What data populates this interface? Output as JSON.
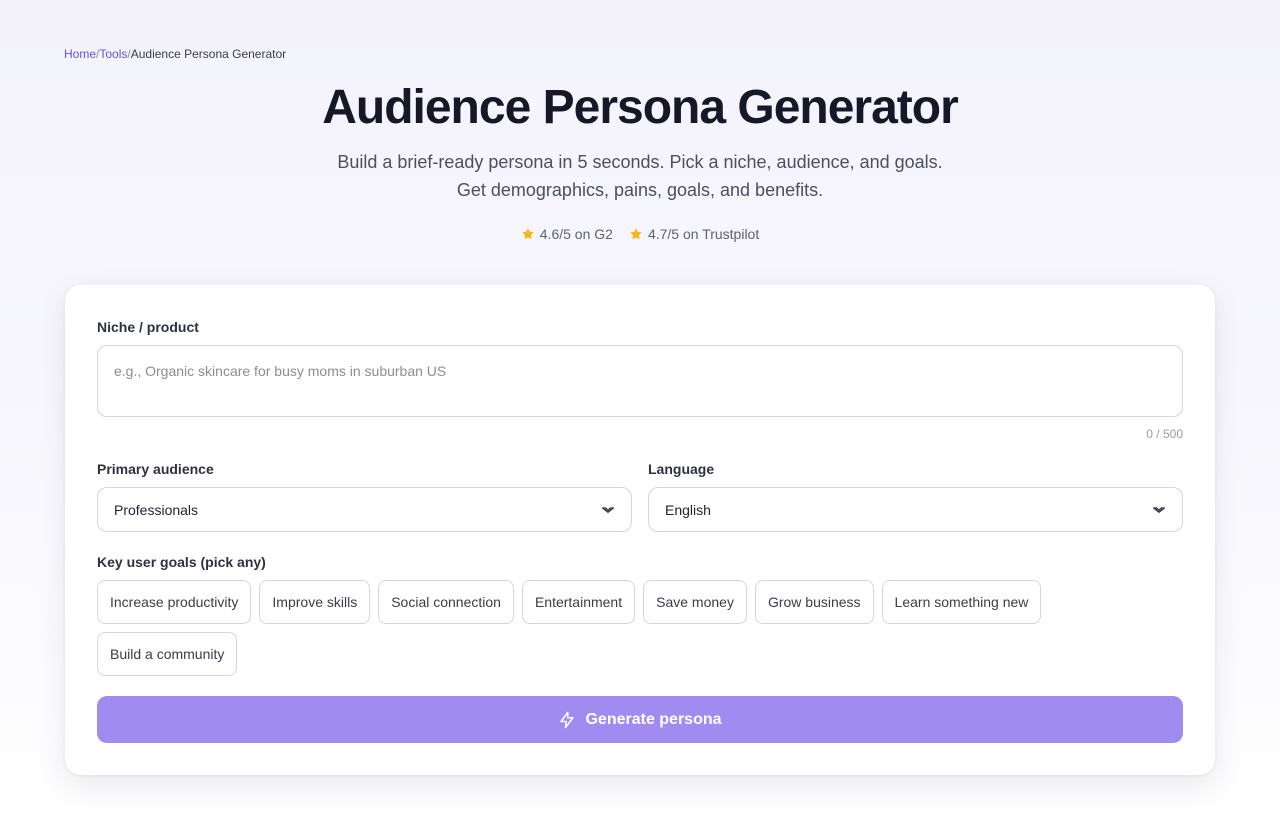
{
  "breadcrumb": {
    "items": [
      "Home",
      "Tools",
      "Audience Persona Generator"
    ],
    "separator": "/"
  },
  "header": {
    "title": "Audience Persona Generator",
    "subtitle_line1": "Build a brief-ready persona in 5 seconds. Pick a niche, audience, and goals.",
    "subtitle_line2": "Get demographics, pains, goals, and benefits."
  },
  "ratings": [
    {
      "icon": "star-icon",
      "text": "4.6/5 on G2"
    },
    {
      "icon": "star-icon",
      "text": "4.7/5 on Trustpilot"
    }
  ],
  "form": {
    "niche": {
      "label": "Niche / product",
      "placeholder": "e.g., Organic skincare for busy moms in suburban US",
      "value": "",
      "counter": "0 / 500"
    },
    "audience": {
      "label": "Primary audience",
      "value": "Professionals"
    },
    "language": {
      "label": "Language",
      "value": "English"
    },
    "goals": {
      "label": "Key user goals (pick any)",
      "options": [
        "Increase productivity",
        "Improve skills",
        "Social connection",
        "Entertainment",
        "Save money",
        "Grow business",
        "Learn something new",
        "Build a community"
      ]
    },
    "submit_label": "Generate persona"
  },
  "colors": {
    "accent": "#a08bf1",
    "link": "#6b4fd8",
    "star": "#f5b818"
  }
}
